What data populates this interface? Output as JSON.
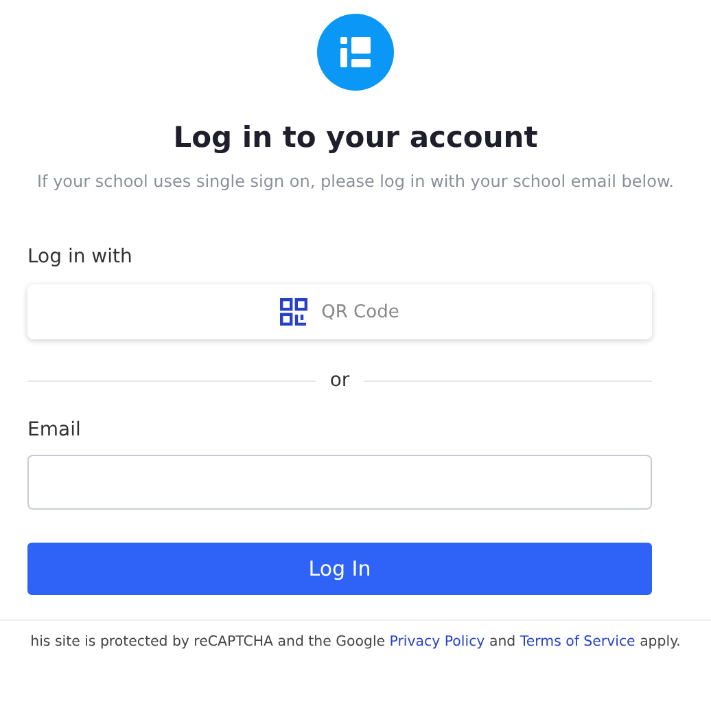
{
  "title": "Log in to your account",
  "subtitle": "If your school uses single sign on, please log in with your school email below.",
  "login_with_label": "Log in with",
  "qr_button": "QR Code",
  "divider_text": "or",
  "email": {
    "label": "Email"
  },
  "submit_button": "Log In",
  "footer": {
    "text_before": "his site is protected by reCAPTCHA and the Google",
    "privacy_link": "Privacy Policy",
    "text_middle": "and",
    "terms_link": "Terms of Service",
    "text_after": "apply."
  }
}
